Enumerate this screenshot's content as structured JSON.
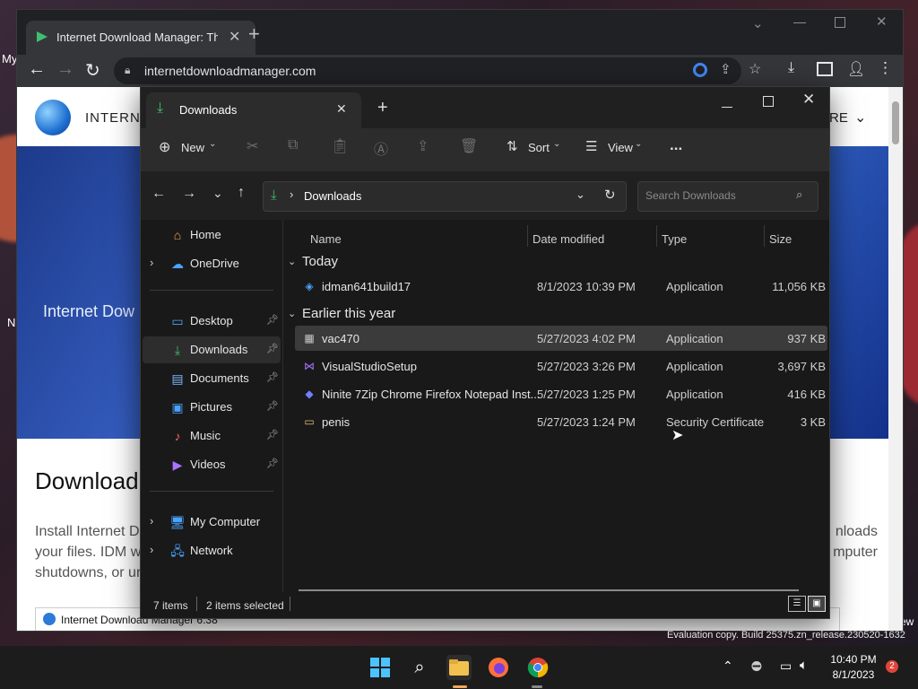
{
  "browser": {
    "tab_title": "Internet Download Manager: The",
    "url": "internetdownloadmanager.com",
    "header_text": "INTERN",
    "header_right": "RE",
    "hero_text": "Internet Dow",
    "body_title": "Download",
    "body_line1_left": "Install Internet D",
    "body_line1_right": "nloads",
    "body_line2_left": "your files. IDM w",
    "body_line2_right": "mputer",
    "body_line3_left": "shutdowns, or ur",
    "popup_title": "Internet Download Manager 6.38",
    "edge_left_text": "My",
    "edge_left_text2": "N",
    "edge_right_text": "ew"
  },
  "explorer": {
    "tab_title": "Downloads",
    "cmd": {
      "new": "New",
      "sort": "Sort",
      "view": "View",
      "more": "..."
    },
    "address": "Downloads",
    "search_placeholder": "Search Downloads",
    "nav": [
      {
        "label": "Home",
        "icon": "home-icon"
      },
      {
        "label": "OneDrive",
        "icon": "cloud-icon"
      },
      {
        "label": "Desktop",
        "icon": "desktop-icon"
      },
      {
        "label": "Downloads",
        "icon": "download-icon"
      },
      {
        "label": "Documents",
        "icon": "documents-icon"
      },
      {
        "label": "Pictures",
        "icon": "pictures-icon"
      },
      {
        "label": "Music",
        "icon": "music-icon"
      },
      {
        "label": "Videos",
        "icon": "videos-icon"
      },
      {
        "label": "My Computer",
        "icon": "computer-icon"
      },
      {
        "label": "Network",
        "icon": "network-icon"
      }
    ],
    "columns": {
      "name": "Name",
      "date": "Date modified",
      "type": "Type",
      "size": "Size"
    },
    "groups": {
      "today": "Today",
      "earlier": "Earlier this year"
    },
    "files": [
      {
        "name": "idman641build17",
        "date": "8/1/2023 10:39 PM",
        "type": "Application",
        "size": "11,056 KB"
      },
      {
        "name": "vac470",
        "date": "5/27/2023 4:02 PM",
        "type": "Application",
        "size": "937 KB"
      },
      {
        "name": "VisualStudioSetup",
        "date": "5/27/2023 3:26 PM",
        "type": "Application",
        "size": "3,697 KB"
      },
      {
        "name": "Ninite 7Zip Chrome Firefox Notepad Inst...",
        "date": "5/27/2023 1:25 PM",
        "type": "Application",
        "size": "416 KB"
      },
      {
        "name": "penis",
        "date": "5/27/2023 1:24 PM",
        "type": "Security Certificate",
        "size": "3 KB"
      }
    ],
    "status": {
      "items": "7 items",
      "selected": "2 items selected"
    }
  },
  "watermark": "Evaluation copy. Build 25375.zn_release.230520-1632",
  "tray": {
    "time": "10:40 PM",
    "date": "8/1/2023",
    "badge": "2"
  },
  "colors": {
    "accent_green": "#3fbf6f",
    "folder_yellow": "#f2c14e",
    "badge_red": "#e0453a"
  }
}
